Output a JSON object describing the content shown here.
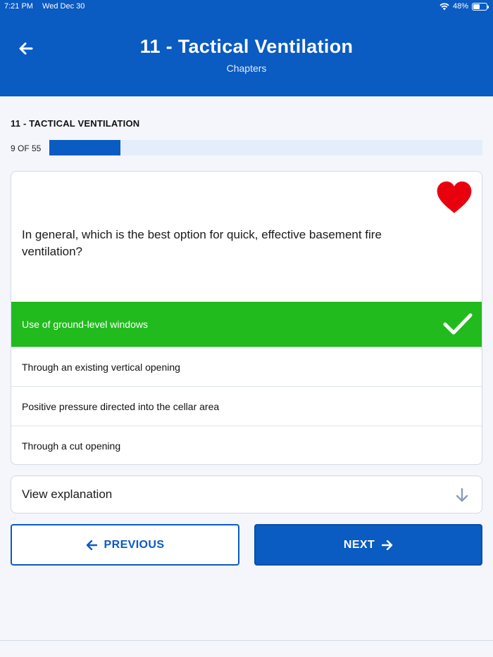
{
  "status_bar": {
    "time": "7:21 PM",
    "date": "Wed Dec 30",
    "battery": "48%",
    "battery_level": 0.48
  },
  "header": {
    "title": "11 - Tactical Ventilation",
    "subtitle": "Chapters"
  },
  "section": {
    "title": "11 - TACTICAL VENTILATION"
  },
  "progress": {
    "label": "9 OF 55",
    "current": 9,
    "total": 55
  },
  "question": {
    "text": "In general, which is the best option for quick, effective basement fire ventilation?",
    "favorited": true,
    "favorite_color": "#e8000e"
  },
  "answers": [
    {
      "label": "Use of ground-level windows",
      "correct": true
    },
    {
      "label": "Through an existing vertical opening",
      "correct": false
    },
    {
      "label": "Positive pressure directed into the cellar area",
      "correct": false
    },
    {
      "label": "Through a cut opening",
      "correct": false
    }
  ],
  "explanation": {
    "label": "View explanation"
  },
  "nav": {
    "previous_label": "PREVIOUS",
    "next_label": "NEXT"
  },
  "colors": {
    "brand": "#0a5bc2",
    "correct": "#22bb1e",
    "background": "#f4f6fb"
  }
}
